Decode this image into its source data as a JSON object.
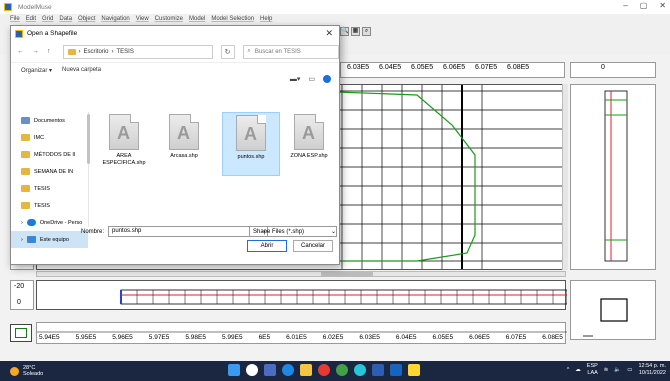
{
  "app": {
    "title": "ModelMuse",
    "menus": [
      "File",
      "Edit",
      "Grid",
      "Data",
      "Object",
      "Navigation",
      "View",
      "Customize",
      "Model",
      "Model Selection",
      "Help"
    ],
    "window_controls": [
      "–",
      "▢",
      "✕"
    ]
  },
  "workspace": {
    "top_ruler_labels": [
      "6.03E5",
      "6.04E5",
      "6.05E5",
      "6.06E5",
      "6.07E5",
      "6.08E5"
    ],
    "top_ruler_right_label": "0",
    "bottom_ruler_labels": [
      "5.94E5",
      "5.95E5",
      "5.96E5",
      "5.97E5",
      "5.98E5",
      "5.99E5",
      "6E5",
      "6.01E5",
      "6.02E5",
      "6.03E5",
      "6.04E5",
      "6.05E5",
      "6.06E5",
      "6.07E5",
      "6.08E5"
    ],
    "cross_left_labels": [
      "-20",
      "0"
    ],
    "left_ruler_label": "8",
    "grid_line_color": "#000000",
    "boundary_color": "#1a9a1a",
    "row_color": "#d9262a",
    "column_color": "#2a3fd9"
  },
  "dialog": {
    "title": "Open a Shapefile",
    "close": "✕",
    "address": [
      "Escritorio",
      "TESIS"
    ],
    "address_sep": "›",
    "search_placeholder": "Buscar en TESIS",
    "organize": "Organizar ▾",
    "new_folder": "Nueva carpeta",
    "nav_items": [
      {
        "label": "Documentos",
        "icon": "documents-icon",
        "type": "doc"
      },
      {
        "label": "IMC",
        "icon": "folder-icon",
        "type": "folder"
      },
      {
        "label": "MÉTODOS DE II",
        "icon": "folder-icon",
        "type": "folder"
      },
      {
        "label": "SEMANA DE IN",
        "icon": "folder-icon",
        "type": "folder"
      },
      {
        "label": "TESIS",
        "icon": "folder-icon",
        "type": "folder"
      },
      {
        "label": "TESIS",
        "icon": "folder-icon",
        "type": "folder"
      },
      {
        "label": "OneDrive - Perso",
        "icon": "cloud-icon",
        "type": "cloud"
      },
      {
        "label": "Este equipo",
        "icon": "computer-icon",
        "type": "pc"
      }
    ],
    "files": [
      {
        "label": "AREA ESPECIFICA.shp",
        "selected": false
      },
      {
        "label": "Arcasa.shp",
        "selected": false
      },
      {
        "label": "puntos.shp",
        "selected": true
      },
      {
        "label": "ZONA ESP.shp",
        "selected": false
      }
    ],
    "name_label": "Nombre:",
    "file_name": "puntos.shp",
    "filter": "Shape Files (*.shp)",
    "open_button": "Abrir",
    "cancel_button": "Cancelar"
  },
  "taskbar": {
    "weather_temp": "28°C",
    "weather_desc": "Soleado",
    "lang_top": "ESP",
    "lang_bottom": "LAA",
    "time": "12:54 p. m.",
    "date": "10/11/2022"
  }
}
